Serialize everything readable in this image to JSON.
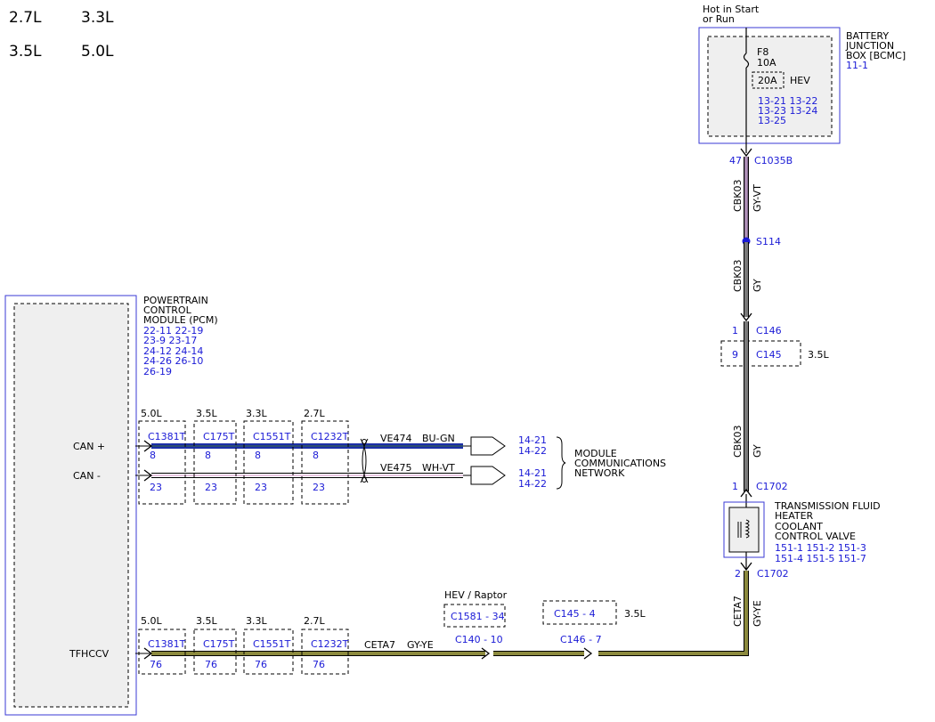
{
  "engines": [
    "2.7L",
    "3.3L",
    "3.5L",
    "5.0L"
  ],
  "power": {
    "hot_label_1": "Hot in Start",
    "hot_label_2": "or Run"
  },
  "bjb": {
    "name": [
      "BATTERY",
      "JUNCTION",
      "BOX [BCMC]"
    ],
    "ref": "11-1",
    "fuse_id": "F8",
    "fuse_rating": "10A",
    "hev_rating": "20A",
    "hev_label": "HEV",
    "refs": [
      "13-21 13-22",
      "13-23 13-24",
      "13-25"
    ]
  },
  "top_connector": {
    "pin": "47",
    "name": "C1035B"
  },
  "wire_top": {
    "circuit": "CBK03",
    "color": "GY-VT"
  },
  "splice": {
    "name": "S114"
  },
  "wire_mid": {
    "circuit": "CBK03",
    "color": "GY"
  },
  "c146": {
    "pin": "1",
    "name": "C146"
  },
  "c145": {
    "pin": "9",
    "name": "C145",
    "engine": "3.5L"
  },
  "wire_low": {
    "circuit": "CBK03",
    "color": "GY"
  },
  "valve": {
    "pin_top": "1",
    "conn_top": "C1702",
    "name": [
      "TRANSMISSION FLUID",
      "HEATER",
      "COOLANT",
      "CONTROL VALVE"
    ],
    "refs": [
      "151-1 151-2 151-3",
      "151-4 151-5 151-7"
    ],
    "pin_bot": "2",
    "conn_bot": "C1702"
  },
  "wire_valve": {
    "circuit": "CETA7",
    "color": "GY-YE"
  },
  "pcm": {
    "name": [
      "POWERTRAIN",
      "CONTROL",
      "MODULE (PCM)"
    ],
    "refs": [
      "22-11 22-19",
      "23-9  23-17",
      "24-12 24-14",
      "24-26 26-10",
      "26-19"
    ],
    "pins": [
      "CAN +",
      "CAN -",
      "TFHCCV"
    ]
  },
  "connectors_can": [
    {
      "engine": "5.0L",
      "name": "C1381T",
      "pin_hi": "8",
      "pin_lo": "23"
    },
    {
      "engine": "3.5L",
      "name": "C175T",
      "pin_hi": "8",
      "pin_lo": "23"
    },
    {
      "engine": "3.3L",
      "name": "C1551T",
      "pin_hi": "8",
      "pin_lo": "23"
    },
    {
      "engine": "2.7L",
      "name": "C1232T",
      "pin_hi": "8",
      "pin_lo": "23"
    }
  ],
  "can_hi_wire": {
    "circuit": "VE474",
    "color": "BU-GN",
    "refs": [
      "14-21",
      "14-22"
    ]
  },
  "can_lo_wire": {
    "circuit": "VE475",
    "color": "WH-VT",
    "refs": [
      "14-21",
      "14-22"
    ]
  },
  "network_label": [
    "MODULE",
    "COMMUNICATIONS",
    "NETWORK"
  ],
  "connectors_tf": [
    {
      "engine": "5.0L",
      "name": "C1381T",
      "pin": "76"
    },
    {
      "engine": "3.5L",
      "name": "C175T",
      "pin": "76"
    },
    {
      "engine": "3.3L",
      "name": "C1551T",
      "pin": "76"
    },
    {
      "engine": "2.7L",
      "name": "C1232T",
      "pin": "76"
    }
  ],
  "tf_wire": {
    "circuit": "CETA7",
    "color": "GY-YE"
  },
  "inline": {
    "hev_label": "HEV / Raptor",
    "c1581": "C1581 - 34",
    "c140": "C140 - 10",
    "c145": "C145  - 4",
    "c145_engine": "3.5L",
    "c146": "C146 - 7"
  },
  "colors": {
    "blue_text": "#1a1ad6",
    "can_hi": "#1b2fa8",
    "can_lo_stripe": "#e3b4d8",
    "gy_ye": "#8c8a3e",
    "gy_vt": "#8a6f93",
    "gy": "#7b7b7b"
  }
}
